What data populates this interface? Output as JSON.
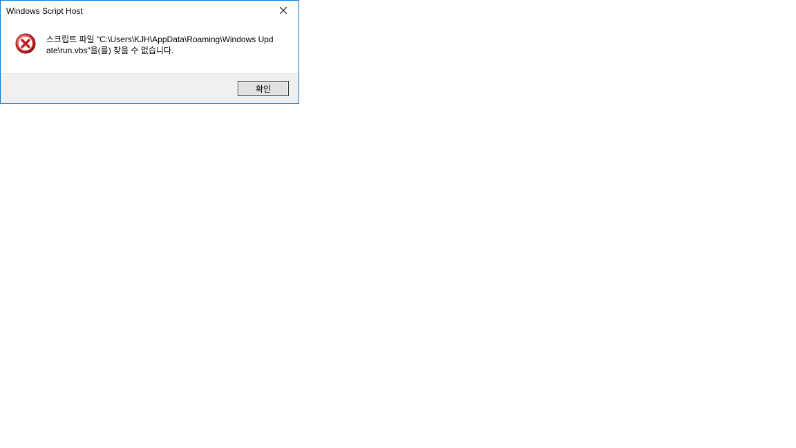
{
  "dialog": {
    "title": "Windows Script Host",
    "message": "스크립트 파일 \"C:\\Users\\KJH\\AppData\\Roaming\\Windows Update\\run.vbs\"을(를) 찾을 수 없습니다.",
    "ok_label": "확인",
    "icon": "error-icon"
  }
}
